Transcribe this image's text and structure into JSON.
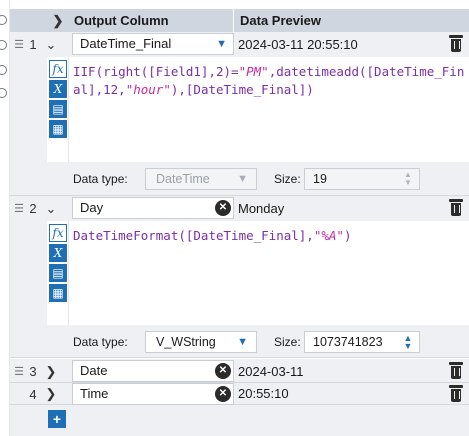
{
  "header": {
    "output_column": "Output Column",
    "data_preview": "Data Preview"
  },
  "rows": [
    {
      "num": "1",
      "name": "DateTime_Final",
      "preview": "2024-03-11 20:55:10",
      "expression_parts": [
        {
          "t": "IIF(right([Field1],2)=",
          "s": false
        },
        {
          "t": "\"PM\"",
          "s": true
        },
        {
          "t": ",datetimeadd([DateTime_Final],12,",
          "s": false
        },
        {
          "t": "\"hour\"",
          "s": true
        },
        {
          "t": "),[DateTime_Final])",
          "s": false
        }
      ],
      "type_label": "Data type:",
      "data_type": "DateTime",
      "size_label": "Size:",
      "size": "19"
    },
    {
      "num": "2",
      "name": "Day",
      "preview": "Monday",
      "expression_parts": [
        {
          "t": "DateTimeFormat([DateTime_Final],",
          "s": false
        },
        {
          "t": "\"%A\"",
          "s": true
        },
        {
          "t": ")",
          "s": false
        }
      ],
      "type_label": "Data type:",
      "data_type": "V_WString",
      "size_label": "Size:",
      "size": "1073741823"
    },
    {
      "num": "3",
      "name": "Date",
      "preview": "2024-03-11"
    },
    {
      "num": "4",
      "name": "Time",
      "preview": "20:55:10"
    }
  ],
  "tools": [
    "fx-icon",
    "variable-x-icon",
    "open-folder-icon",
    "save-icon"
  ],
  "colors": {
    "accent": "#1f6fb5",
    "header_bg": "#cfd6df",
    "row_bg": "#eef0f3",
    "expr_fn": "#7a2fa6",
    "expr_str": "#c7299e"
  }
}
